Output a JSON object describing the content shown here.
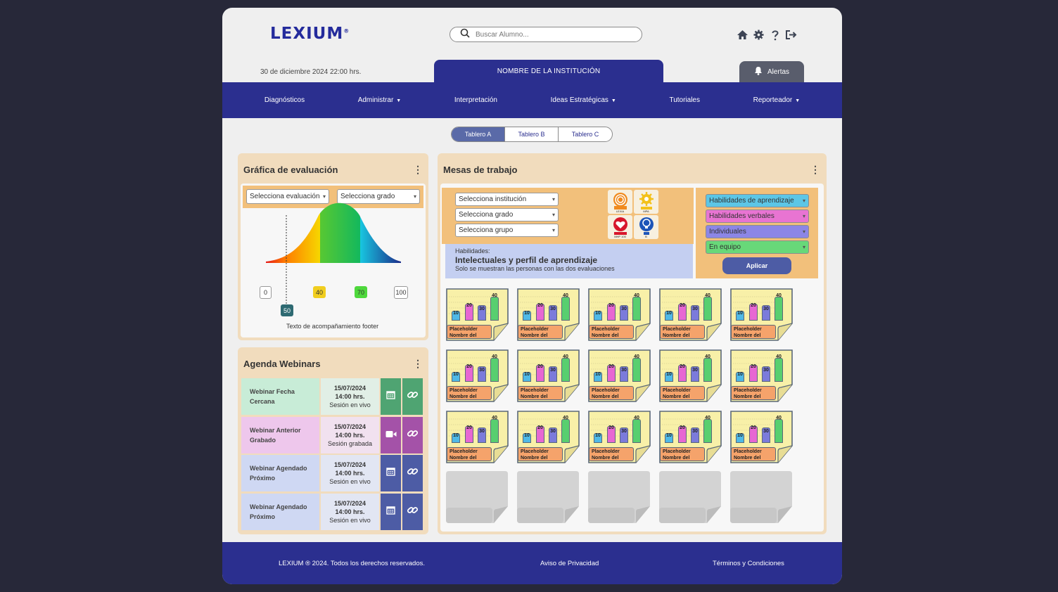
{
  "header": {
    "logo": "LEXIUM",
    "logo_mark": "®",
    "search_placeholder": "Buscar Alumno...",
    "date": "30 de diciembre 2024 22:00 hrs.",
    "institution": "NOMBRE DE LA INSTITUCIÓN",
    "alerts": "Alertas",
    "icons": [
      "home-icon",
      "gear-icon",
      "help-icon",
      "logout-icon"
    ]
  },
  "nav": {
    "items": [
      {
        "label": "Diagnósticos",
        "dropdown": false
      },
      {
        "label": "Administrar",
        "dropdown": true
      },
      {
        "label": "Interpretación",
        "dropdown": false
      },
      {
        "label": "Ideas Estratégicas",
        "dropdown": true
      },
      {
        "label": "Tutoriales",
        "dropdown": false
      },
      {
        "label": "Reporteador",
        "dropdown": true
      }
    ]
  },
  "boards": {
    "tabs": [
      "Tablero A",
      "Tablero B",
      "Tablero C"
    ],
    "active": 0
  },
  "evaluation": {
    "title": "Gráfica de evaluación",
    "select_eval": "Selecciona evaluación",
    "select_grade": "Selecciona grado",
    "ticks": [
      "0",
      "40",
      "70",
      "100"
    ],
    "marker": "50",
    "footer": "Texto de acompañamiento footer"
  },
  "webinars": {
    "title": "Agenda Webinars",
    "rows": [
      {
        "name": "Webinar Fecha Cercana",
        "date": "15/07/2024",
        "time": "14:00 hrs.",
        "status": "Sesión en vivo",
        "bg": "#c8ecd7",
        "dbg": "#e1efe6",
        "btn": "#4fa472",
        "icon": "calendar-icon"
      },
      {
        "name": "Webinar Anterior Grabado",
        "date": "15/07/2024",
        "time": "14:00 hrs.",
        "status": "Sesión grabada",
        "bg": "#eec7ec",
        "dbg": "#f1e1ef",
        "btn": "#a452a8",
        "icon": "video-icon"
      },
      {
        "name": "Webinar Agendado Próximo",
        "date": "15/07/2024",
        "time": "14:00 hrs.",
        "status": "Sesión en vivo",
        "bg": "#cfd8f3",
        "dbg": "#e2e6f3",
        "btn": "#4d5ca5",
        "icon": "calendar-icon"
      },
      {
        "name": "Webinar Agendado Próximo",
        "date": "15/07/2024",
        "time": "14:00 hrs.",
        "status": "Sesión en vivo",
        "bg": "#cfd8f3",
        "dbg": "#e2e6f3",
        "btn": "#4d5ca5",
        "icon": "calendar-icon"
      }
    ]
  },
  "workspace": {
    "title": "Mesas de trabajo",
    "selects": [
      "Selecciona institución",
      "Selecciona grado",
      "Selecciona grupo"
    ],
    "badges": [
      "LEXIA",
      "MPA",
      "MHP 100",
      "B"
    ],
    "habilidades_label": "Habilidades:",
    "habilidades_title": "Intelectuales y perfil de aprendizaje",
    "habilidades_note": "Solo se muestran las personas con las dos evaluaciones",
    "filters": [
      {
        "label": "Habilidades de aprendizaje",
        "color": "#5cc6e6"
      },
      {
        "label": "Habilidades verbales",
        "color": "#e874d2"
      },
      {
        "label": "Individuales",
        "color": "#8c86e6"
      },
      {
        "label": "En equipo",
        "color": "#68d879"
      }
    ],
    "apply": "Aplicar",
    "card": {
      "values": [
        "10",
        "20",
        "30",
        "40"
      ],
      "name": "Placeholder Nombre del"
    }
  },
  "footer": {
    "copyright": "LEXIUM ® 2024. Todos los derechos reservados.",
    "privacy": "Aviso de Privacidad",
    "terms": "Términos y Condiciones"
  }
}
